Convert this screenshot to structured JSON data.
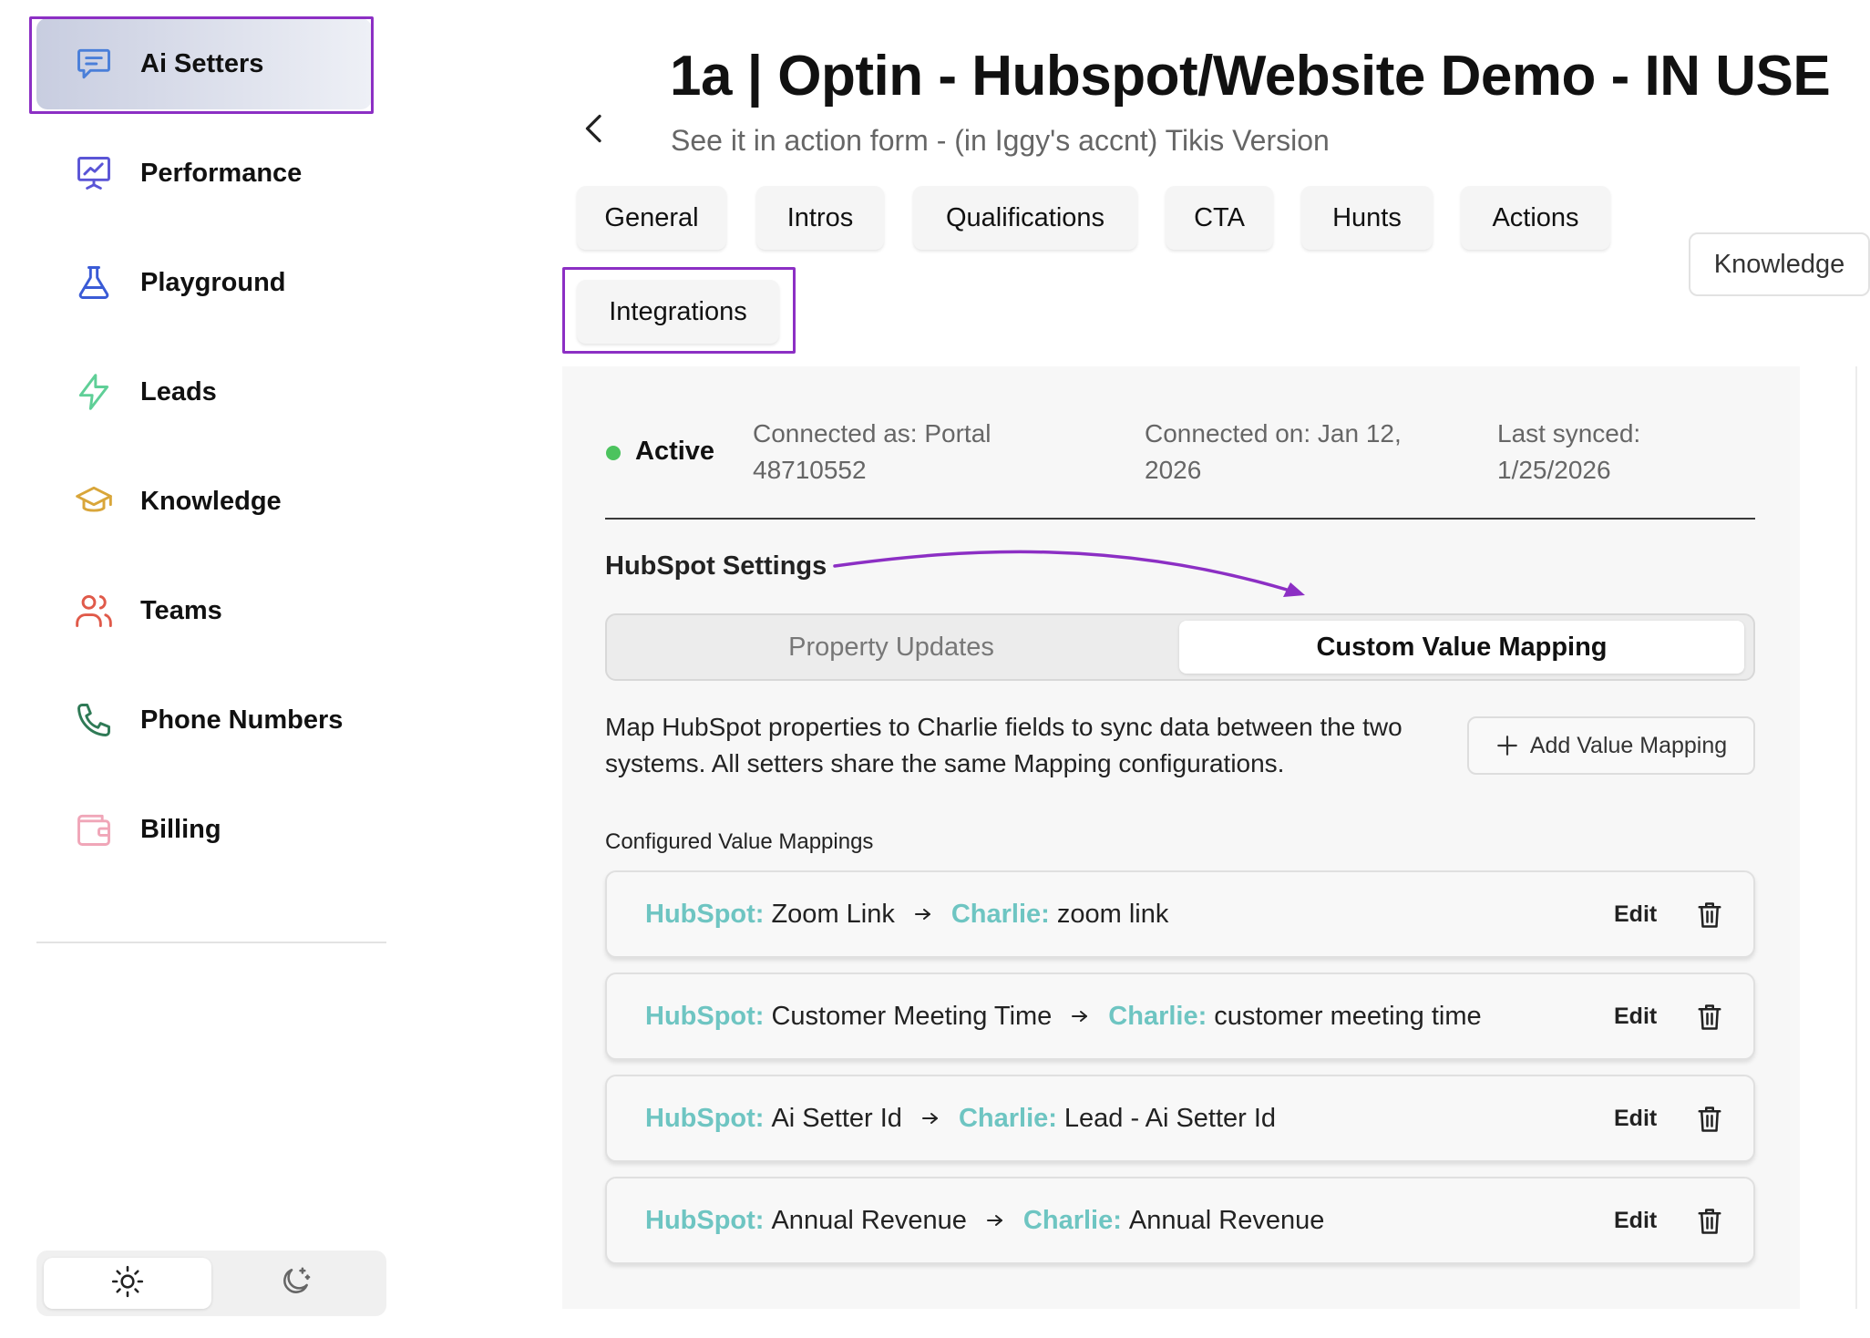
{
  "sidebar": {
    "items": [
      {
        "label": "Ai Setters",
        "icon": "chat-icon",
        "color": "#4a7fd9"
      },
      {
        "label": "Performance",
        "icon": "chart-board-icon",
        "color": "#5a55d6"
      },
      {
        "label": "Playground",
        "icon": "flask-icon",
        "color": "#3a5bd6"
      },
      {
        "label": "Leads",
        "icon": "lightning-icon",
        "color": "#5fcf97"
      },
      {
        "label": "Knowledge",
        "icon": "graduation-cap-icon",
        "color": "#d9a63a"
      },
      {
        "label": "Teams",
        "icon": "users-icon",
        "color": "#e05a4a"
      },
      {
        "label": "Phone Numbers",
        "icon": "phone-icon",
        "color": "#2f7a56"
      },
      {
        "label": "Billing",
        "icon": "wallet-icon",
        "color": "#f0a6b8"
      }
    ],
    "theme": {
      "light": "sun-icon",
      "dark": "moon-icon"
    }
  },
  "header": {
    "title": "1a | Optin - Hubspot/Website Demo - IN USE",
    "subtitle": "See it in action form - (in Iggy's accnt) Tikis Version"
  },
  "tabs": [
    "General",
    "Intros",
    "Qualifications",
    "CTA",
    "Hunts",
    "Actions",
    "Integrations",
    "Knowledge"
  ],
  "integration": {
    "status": "Active",
    "status_color": "#4cc35e",
    "connected_as_line1": "Connected as: Portal",
    "connected_as_line2": "48710552",
    "connected_on_line1": "Connected on: Jan 12,",
    "connected_on_line2": "2026",
    "last_synced_line1": "Last synced:",
    "last_synced_line2": "1/25/2026",
    "settings_title": "HubSpot Settings",
    "segments": [
      "Property Updates",
      "Custom Value Mapping"
    ],
    "description": "Map HubSpot properties to Charlie fields to sync data between the two systems. All setters share the same Mapping configurations.",
    "add_button": "Add Value Mapping",
    "list_title": "Configured Value Mappings",
    "accent_color": "#6ec5c2",
    "annotation_color": "#8c2fc4"
  },
  "mappings": [
    {
      "hubspot_key": "HubSpot:",
      "hubspot_value": "Zoom Link",
      "charlie_key": "Charlie:",
      "charlie_value": "zoom link",
      "edit": "Edit"
    },
    {
      "hubspot_key": "HubSpot:",
      "hubspot_value": "Customer Meeting Time",
      "charlie_key": "Charlie:",
      "charlie_value": "customer meeting time",
      "edit": "Edit"
    },
    {
      "hubspot_key": "HubSpot:",
      "hubspot_value": "Ai Setter Id",
      "charlie_key": "Charlie:",
      "charlie_value": "Lead - Ai Setter Id",
      "edit": "Edit"
    },
    {
      "hubspot_key": "HubSpot:",
      "hubspot_value": "Annual Revenue",
      "charlie_key": "Charlie:",
      "charlie_value": "Annual Revenue",
      "edit": "Edit"
    }
  ]
}
